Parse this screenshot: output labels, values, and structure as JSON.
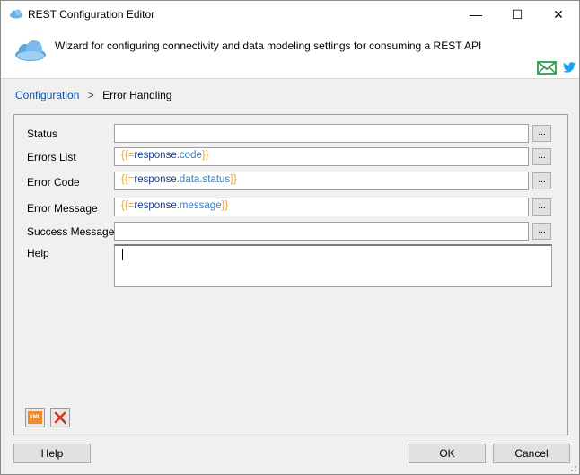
{
  "window": {
    "title": "REST Configuration Editor",
    "minimize_glyph": "—",
    "maximize_glyph": "☐",
    "close_glyph": "✕"
  },
  "header": {
    "subtitle": "Wizard for configuring connectivity and data modeling settings for consuming a REST API",
    "icons": [
      "cloud-icon",
      "mail-icon",
      "twitter-icon"
    ]
  },
  "breadcrumb": {
    "root": "Configuration",
    "separator": ">",
    "current": "Error Handling"
  },
  "form": {
    "status": {
      "label": "Status",
      "value": ""
    },
    "errors_list": {
      "label": "Errors List",
      "value": "{{=response.code}}"
    },
    "error_code": {
      "label": "Error Code",
      "value": "{{=response.data.status}}"
    },
    "error_message": {
      "label": "Error Message",
      "value": "{{=response.message}}"
    },
    "success_message": {
      "label": "Success Message",
      "value": ""
    },
    "help": {
      "label": "Help",
      "value": ""
    },
    "ellipsis": "..."
  },
  "toolbar": {
    "xml_label": "XML"
  },
  "buttons": {
    "help": "Help",
    "ok": "OK",
    "cancel": "Cancel"
  },
  "colors": {
    "link": "#0b54b5",
    "bracket": "#e8a33b",
    "object": "#1a3a8a",
    "property": "#3a7ec0",
    "mail": "#2e9e4e",
    "twitter": "#1da1f2",
    "delete": "#e0301e"
  }
}
